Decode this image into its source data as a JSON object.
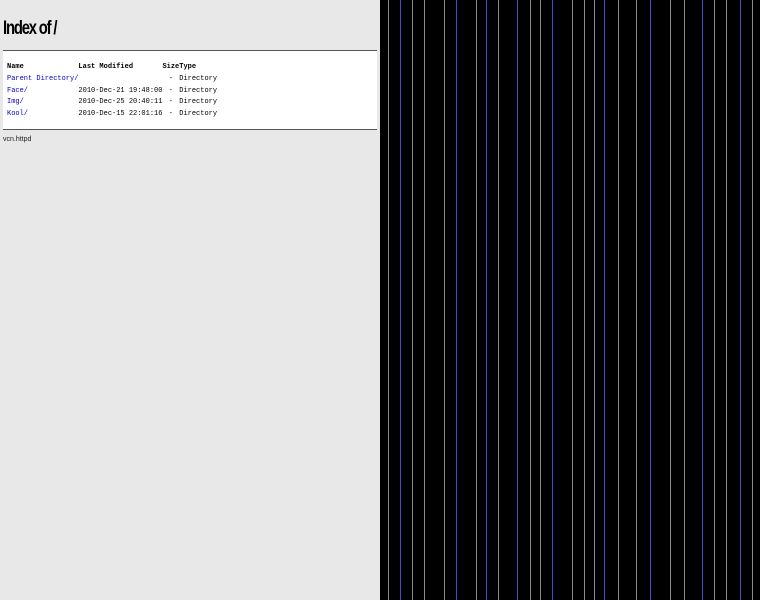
{
  "page": {
    "title": "Index of /"
  },
  "listing": {
    "headers": {
      "name": "Name",
      "last_modified": "Last Modified",
      "size": "Size",
      "type": "Type"
    },
    "rows": [
      {
        "name": "Parent Directory/",
        "last_modified": "",
        "size": "-",
        "type": "Directory"
      },
      {
        "name": "Face/",
        "last_modified": "2010-Dec-21 19:48:00",
        "size": "-",
        "type": "Directory"
      },
      {
        "name": "Img/",
        "last_modified": "2010-Dec-25 20:40:11",
        "size": "-",
        "type": "Directory"
      },
      {
        "name": "Kool/",
        "last_modified": "2010-Dec-15 22:01:16",
        "size": "-",
        "type": "Directory"
      }
    ]
  },
  "footer": {
    "server": "vcn.httpd"
  },
  "colors": {
    "left_background": "#e8e8e8",
    "listing_background": "#ffffff",
    "link": "#0000cc",
    "right_background": "#000000",
    "stripe_gray": "#8a8a8a",
    "stripe_blue": "#4a4ad0"
  }
}
